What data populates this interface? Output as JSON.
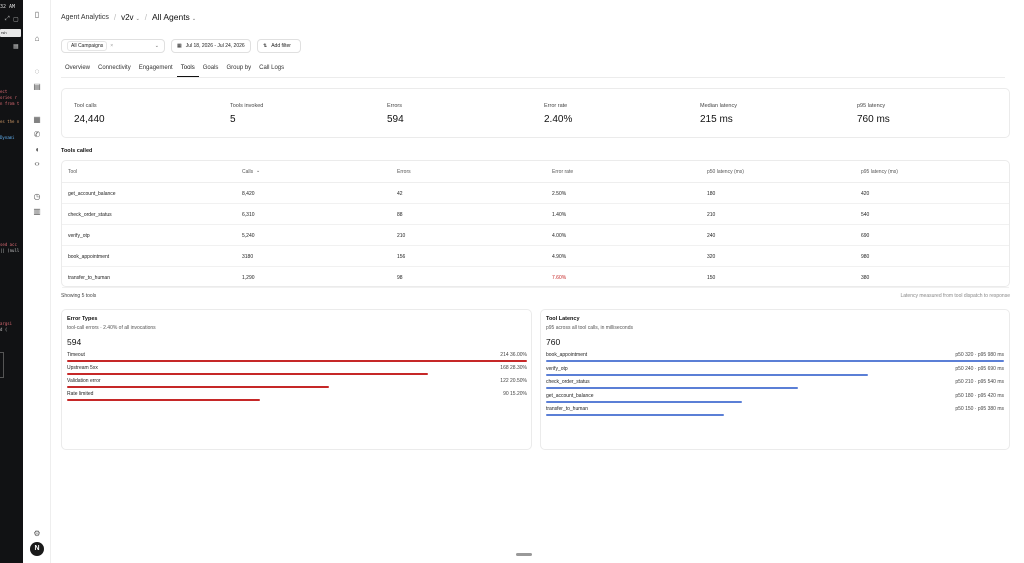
{
  "terminal": {
    "time": "32 AM",
    "tab_label": "rsh",
    "lines": [
      {
        "text": "ect",
        "color": "#e06c75"
      },
      {
        "text": "ories r",
        "color": "#e06c75"
      },
      {
        "text": "n from t",
        "color": "#e06c75"
      },
      {
        "text": "es the n",
        "color": "#d19a66"
      },
      {
        "text": "Dynami",
        "color": "#61afef"
      },
      {
        "text": "sed acc",
        "color": "#e06c75"
      },
      {
        "text": "|| (null",
        "color": "#c8c8c8"
      },
      {
        "text": "argsi",
        "color": "#e06c75"
      },
      {
        "text": "d (",
        "color": "#c8c8c8"
      }
    ]
  },
  "sidebar": {
    "icons": [
      "panel-toggle-icon",
      "home-icon",
      "chat-icon",
      "inbox-icon",
      "calendar-icon",
      "phone-icon",
      "megaphone-icon",
      "code-icon",
      "history-icon",
      "book-icon",
      "settings-icon"
    ],
    "avatar_initial": "N"
  },
  "header": {
    "breadcrumb_root": "Agent Analytics",
    "workspace": "v2v",
    "agents": "All Agents"
  },
  "filters": {
    "campaign": "All Campaigns",
    "date_range": "Jul 18, 2026 - Jul 24, 2026",
    "add_filter": "Add filter"
  },
  "tabs": [
    {
      "label": "Overview",
      "active": false
    },
    {
      "label": "Connectivity",
      "active": false
    },
    {
      "label": "Engagement",
      "active": false
    },
    {
      "label": "Tools",
      "active": true
    },
    {
      "label": "Goals",
      "active": false
    },
    {
      "label": "Group by",
      "active": false
    },
    {
      "label": "Call Logs",
      "active": false
    }
  ],
  "stats": [
    {
      "label": "Tool calls",
      "value": "24,440"
    },
    {
      "label": "Tools invoked",
      "value": "5"
    },
    {
      "label": "Errors",
      "value": "594"
    },
    {
      "label": "Error rate",
      "value": "2.40%"
    },
    {
      "label": "Median latency",
      "value": "215 ms"
    },
    {
      "label": "p95 latency",
      "value": "760 ms"
    }
  ],
  "tools_table": {
    "title": "Tools called",
    "columns": [
      "Tool",
      "Calls",
      "Errors",
      "Error rate",
      "p50 latency (ms)",
      "p95 latency (ms)"
    ],
    "rows": [
      {
        "tool": "get_account_balance",
        "calls": "8,420",
        "errors": "42",
        "error_rate": "2.50%",
        "p50": "180",
        "p95": "420",
        "highlight": false
      },
      {
        "tool": "check_order_status",
        "calls": "6,310",
        "errors": "88",
        "error_rate": "1.40%",
        "p50": "210",
        "p95": "540",
        "highlight": false
      },
      {
        "tool": "verify_otp",
        "calls": "5,240",
        "errors": "210",
        "error_rate": "4.00%",
        "p50": "240",
        "p95": "690",
        "highlight": false
      },
      {
        "tool": "book_appointment",
        "calls": "3180",
        "errors": "156",
        "error_rate": "4.90%",
        "p50": "320",
        "p95": "980",
        "highlight": false
      },
      {
        "tool": "transfer_to_human",
        "calls": "1,290",
        "errors": "98",
        "error_rate": "7.60%",
        "p50": "150",
        "p95": "380",
        "highlight": true
      }
    ],
    "footer_left": "Showing 5 tools",
    "footer_right": "Latency measured from tool dispatch to response"
  },
  "error_types": {
    "title": "Error Types",
    "subtitle": "tool-call errors · 2.40% of all invocations",
    "total": "594",
    "color": "#c62828",
    "items": [
      {
        "label": "Timeout",
        "value": "214 36.00%",
        "fraction": 1.0
      },
      {
        "label": "Upstream 5xx",
        "value": "168 28.30%",
        "fraction": 0.785
      },
      {
        "label": "Validation error",
        "value": "122 20.50%",
        "fraction": 0.57
      },
      {
        "label": "Rate limited",
        "value": "90 15.20%",
        "fraction": 0.42
      }
    ]
  },
  "tool_latency": {
    "title": "Tool Latency",
    "subtitle": "p95 across all tool calls, in milliseconds",
    "total": "760",
    "color": "#5b7fd6",
    "items": [
      {
        "label": "book_appointment",
        "value": "p50 320 · p95 980 ms",
        "fraction": 1.0
      },
      {
        "label": "verify_otp",
        "value": "p50 240 · p95 690 ms",
        "fraction": 0.704
      },
      {
        "label": "check_order_status",
        "value": "p50 210 · p95 540 ms",
        "fraction": 0.551
      },
      {
        "label": "get_account_balance",
        "value": "p50 180 · p95 420 ms",
        "fraction": 0.429
      },
      {
        "label": "transfer_to_human",
        "value": "p50 150 · p95 380 ms",
        "fraction": 0.388
      }
    ]
  }
}
